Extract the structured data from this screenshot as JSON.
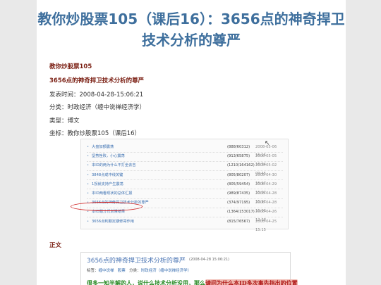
{
  "article": {
    "title": "教你炒股票105（课后16）：3656点的神奇捍卫技术分析的尊严",
    "series_name": "教你炒股票105",
    "subtitle": "3656点的神奇捍卫技术分析的尊严",
    "publish_time": "发表时间：2008-04-28-15:06:21",
    "category": "分类：时政经济（缠中说禅经济学）",
    "type": "类型：博文",
    "tag": "坐标：教你炒股票105（课后16）",
    "body_label": "正文"
  },
  "list_screenshot": {
    "rows": [
      {
        "title": "大盘加额震荡",
        "counts": "(888/60312)",
        "date": "2008-05-06 15:25"
      },
      {
        "title": "坚势挫败，小心震荡",
        "counts": "(913/65875)",
        "date": "2008-05-05 16:34"
      },
      {
        "title": "本ID的两为什么不打坐去吉",
        "counts": "(1210/164162)",
        "date": "2008-05-02 09:45"
      },
      {
        "title": "3848点成中线关键",
        "counts": "(805/80207)",
        "date": "2008-04-30 15:17"
      },
      {
        "title": "1拐就支持产生震荡",
        "counts": "(805/59454)",
        "date": "2008-04-29 15:02"
      },
      {
        "title": "本ID两看现状的总体汇报",
        "counts": "(989/87435)",
        "date": "2008-04-28 15:17"
      },
      {
        "title": "3656点的神奇捍卫技术分析的尊严",
        "counts": "(374/97195)",
        "date": "2008-04-28 15:06"
      },
      {
        "title": "本ID题分们划慢结果",
        "counts": "(1364/153017)",
        "date": "2008-04-26 12:38"
      },
      {
        "title": "3656点利期定期修哥作用",
        "counts": "(815/76567)",
        "date": "2008-04-25 15:15"
      }
    ]
  },
  "article_screenshot": {
    "title": "3656点的神奇捍卫技术分析的尊严",
    "date": "(2008-04-28 15:06:21)",
    "tag_label": "标签：",
    "tag_value": "缠中说禅",
    "share_label": "股票",
    "category_label": "分类：",
    "category_value": "时政经济（缠中说禅经济学）",
    "first_line": "很多一知半解的人，说什么技术分析没用，那么",
    "first_line_hl": "请问为什么本ID多次事先指出的位置"
  }
}
